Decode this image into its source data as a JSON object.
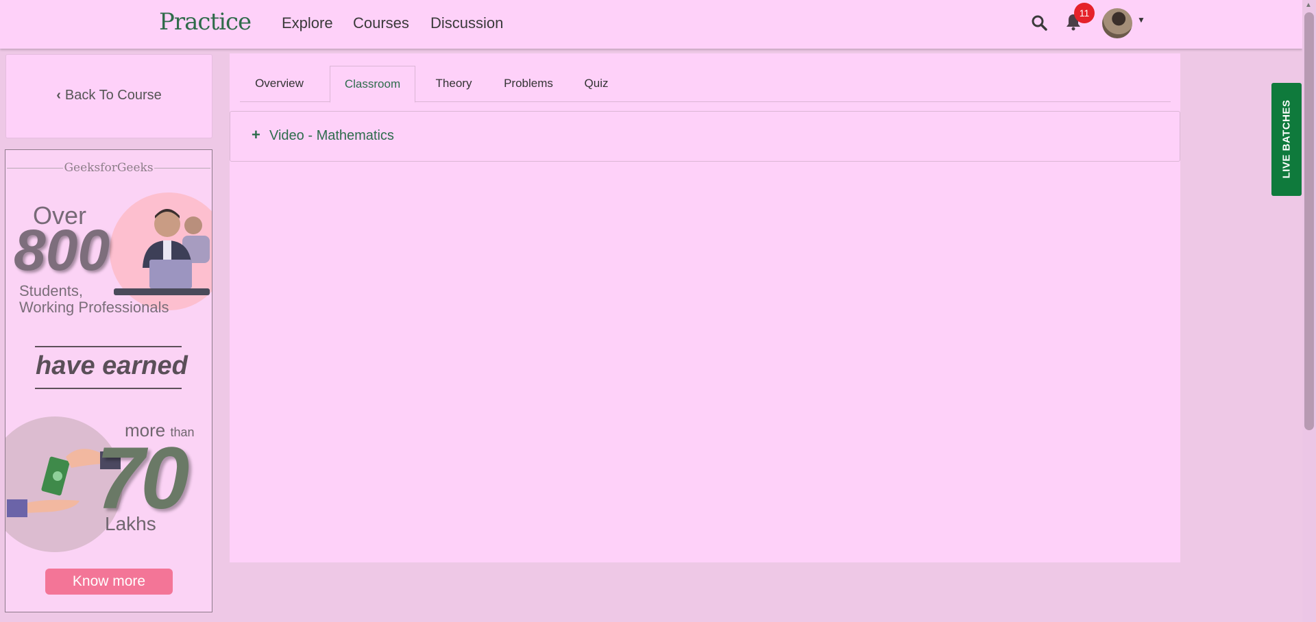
{
  "header": {
    "logo": "Practice",
    "nav": [
      "Explore",
      "Courses",
      "Discussion"
    ],
    "notification_count": "11",
    "icons": [
      "search-icon",
      "bell-icon",
      "avatar",
      "caret-down-icon"
    ]
  },
  "sidebar": {
    "back_label": "Back To Course",
    "ad": {
      "brand": "GeeksforGeeks",
      "over": "Over",
      "number": "800",
      "students_line1": "Students,",
      "students_line2": "Working Professionals",
      "earned": "have earned",
      "more": "more",
      "than": "than",
      "amount": "70",
      "unit": "Lakhs",
      "cta": "Know more"
    }
  },
  "tabs": [
    {
      "label": "Overview",
      "active": false
    },
    {
      "label": "Classroom",
      "active": true
    },
    {
      "label": "Theory",
      "active": false
    },
    {
      "label": "Problems",
      "active": false
    },
    {
      "label": "Quiz",
      "active": false
    }
  ],
  "accordion": {
    "icon": "plus-icon",
    "label": "Video - Mathematics"
  },
  "live_batches": "LIVE BATCHES",
  "colors": {
    "accent": "#2d6c4c",
    "page_bg": "#fed1f9",
    "badge": "#e5222a",
    "live": "#0f7a3c",
    "cta": "#f37597"
  }
}
